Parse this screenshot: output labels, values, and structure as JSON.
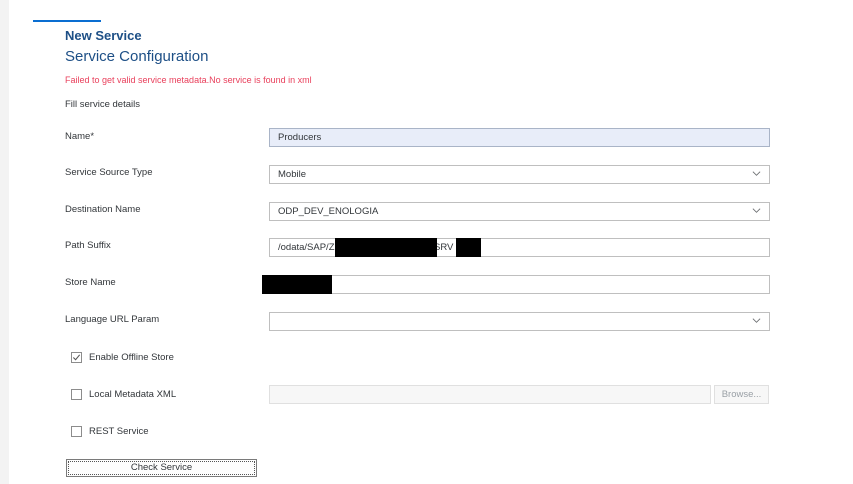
{
  "header": {
    "title": "New Service",
    "subtitle": "Service Configuration",
    "error": "Failed to get valid service metadata.No service is found in xml",
    "section": "Fill service details"
  },
  "form": {
    "name": {
      "label": "Name*",
      "value": "Producers"
    },
    "source_type": {
      "label": "Service Source Type",
      "value": "Mobile"
    },
    "destination": {
      "label": "Destination Name",
      "value": "ODP_DEV_ENOLOGIA"
    },
    "path_suffix": {
      "label": "Path Suffix",
      "value_prefix": "/odata/SAP/Z",
      "value_mid": "SRV"
    },
    "store_name": {
      "label": "Store Name",
      "value": ""
    },
    "language": {
      "label": "Language URL Param",
      "value": ""
    }
  },
  "options": {
    "offline": {
      "label": "Enable Offline Store",
      "checked": true
    },
    "local_metadata": {
      "label": "Local Metadata XML",
      "checked": false,
      "browse_label": "Browse..."
    },
    "rest": {
      "label": "REST Service",
      "checked": false
    }
  },
  "actions": {
    "check_service": "Check Service"
  },
  "colors": {
    "title": "#1d4f86",
    "error": "#e9405c",
    "name_field_bg": "#e8edf9"
  }
}
